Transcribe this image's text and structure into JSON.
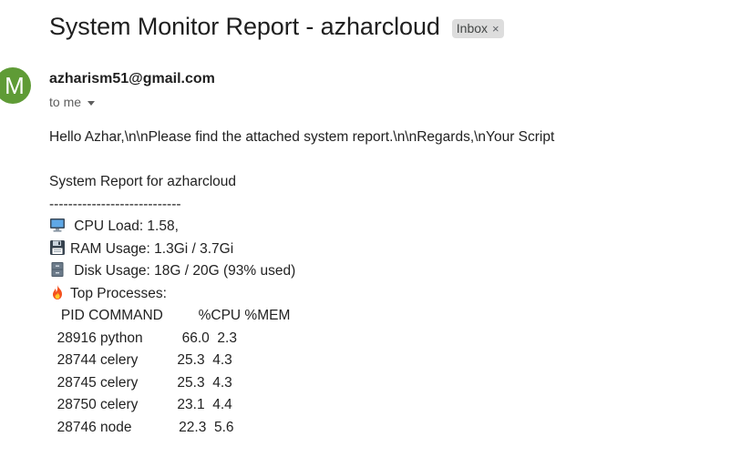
{
  "email": {
    "subject": "System Monitor Report - azharcloud",
    "label": "Inbox",
    "label_close": "×",
    "avatar_letter": "M",
    "sender": "azharism51@gmail.com",
    "recipient": "to me",
    "greeting": "Hello Azhar,\\n\\nPlease find the attached system report.\\n\\nRegards,\\nYour Script"
  },
  "report": {
    "title": "System Report for azharcloud",
    "separator": "----------------------------",
    "cpu": " CPU Load: 1.58,",
    "ram": "RAM Usage: 1.3Gi / 3.7Gi",
    "disk": " Disk Usage: 18G / 20G (93% used)",
    "top_processes": "Top Processes:",
    "process_header": "   PID COMMAND         %CPU %MEM",
    "processes": [
      "  28916 python          66.0  2.3",
      "  28744 celery          25.3  4.3",
      "  28745 celery          25.3  4.3",
      "  28750 celery          23.1  4.4",
      "  28746 node            22.3  5.6"
    ]
  },
  "icons": {
    "cpu": "desktop-computer-icon",
    "ram": "floppy-disk-icon",
    "disk": "file-cabinet-icon",
    "processes": "fire-icon"
  },
  "colors": {
    "avatar": "#5f9b36",
    "label_bg": "#dddddd"
  }
}
